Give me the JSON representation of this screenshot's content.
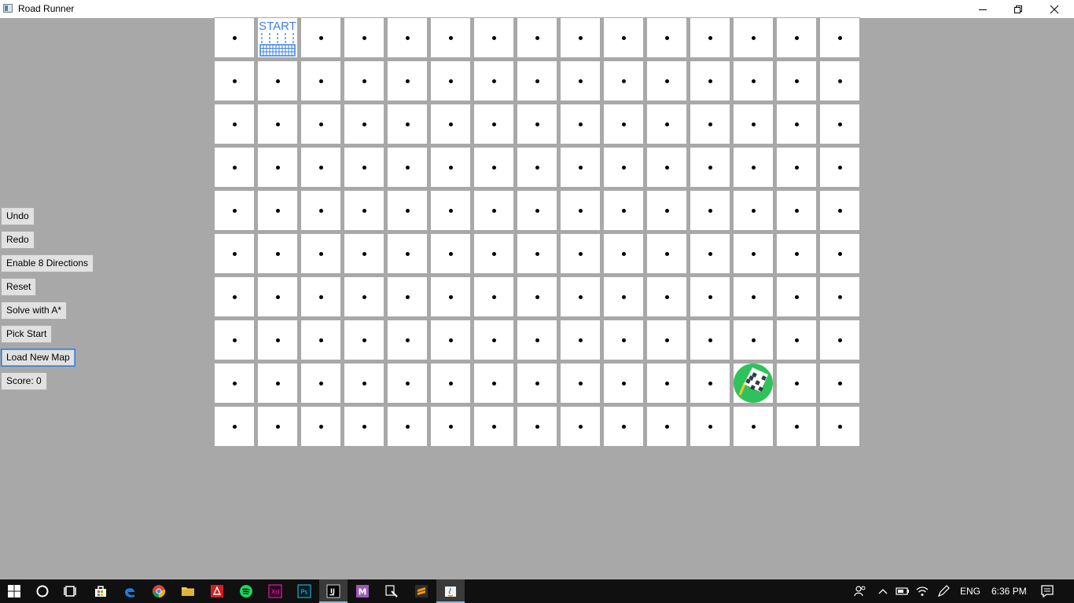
{
  "window": {
    "title": "Road Runner",
    "controls": [
      "minimize-icon",
      "restore-icon",
      "close-icon"
    ]
  },
  "sidebar": {
    "buttons": [
      {
        "label": "Undo"
      },
      {
        "label": "Redo"
      },
      {
        "label": "Enable 8 Directions"
      },
      {
        "label": "Reset"
      },
      {
        "label": "Solve with A*"
      },
      {
        "label": "Pick Start"
      },
      {
        "label": "Load New Map"
      },
      {
        "label": "Score: 0"
      }
    ]
  },
  "grid": {
    "rows": 10,
    "cols": 15,
    "start": {
      "row": 0,
      "col": 1,
      "label": "START",
      "icon": "start-line-icon"
    },
    "finish": {
      "row": 8,
      "col": 12,
      "icon": "checkered-flag-icon"
    },
    "cell_icon": "dot-icon"
  },
  "taskbar": {
    "apps": [
      "windows-start-icon",
      "cortana-search-icon",
      "task-view-icon",
      "store-icon",
      "edge-icon",
      "chrome-icon",
      "file-explorer-icon",
      "acrobat-icon",
      "spotify-icon",
      "adobe-xd-icon",
      "photoshop-icon",
      "intellij-icon",
      "meister-icon",
      "app-tool-icon",
      "sublime-text-icon",
      "java-app-icon"
    ],
    "active_app": "java-app-icon",
    "tray": {
      "language": "ENG",
      "time": "6:36 PM"
    }
  },
  "colors": {
    "background": "#a8a8a8",
    "cell": "#ffffff",
    "start_blue": "#3b82e0",
    "finish_green": "#2fc25a",
    "taskbar": "#101010"
  }
}
